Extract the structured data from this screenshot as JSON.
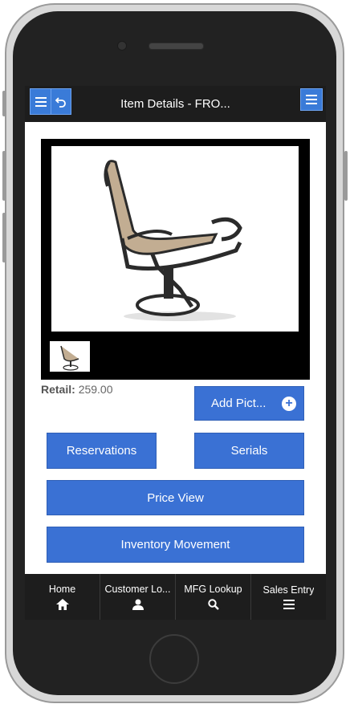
{
  "header": {
    "title": "Item Details - FRO...",
    "menu_icon": "menu-icon",
    "back_icon": "undo-icon",
    "right_menu_icon": "menu-icon"
  },
  "product": {
    "retail_label": "Retail:",
    "retail_value": "259.00"
  },
  "buttons": {
    "add_picture": "Add Pict...",
    "reservations": "Reservations",
    "serials": "Serials",
    "price_view": "Price View",
    "inventory_movement": "Inventory Movement"
  },
  "bottom_nav": {
    "items": [
      {
        "label": "Home",
        "icon": "home-icon"
      },
      {
        "label": "Customer Lo...",
        "icon": "user-icon"
      },
      {
        "label": "MFG Lookup",
        "icon": "search-icon"
      },
      {
        "label": "Sales Entry",
        "icon": "menu-icon"
      }
    ]
  },
  "colors": {
    "accent": "#3a71d4",
    "bar": "#1d1d1d"
  }
}
